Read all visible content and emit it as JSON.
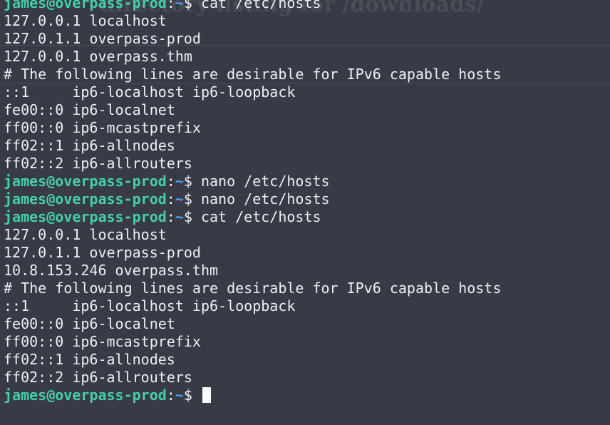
{
  "background_text": "directory listing for /downloads/",
  "colors": {
    "background": "#383a45",
    "user_host": "#45cfa6",
    "path": "#4ea0ff",
    "text": "#eceff4"
  },
  "prompt": {
    "user_host": "james@overpass-prod",
    "colon": ":",
    "path": "~",
    "dollar": "$ "
  },
  "lines": [
    {
      "type": "prompt",
      "command": "cat /etc/hosts"
    },
    {
      "type": "output",
      "text": "127.0.0.1 localhost"
    },
    {
      "type": "output",
      "text": "127.0.1.1 overpass-prod"
    },
    {
      "type": "output",
      "text": "127.0.0.1 overpass.thm"
    },
    {
      "type": "output",
      "text": "# The following lines are desirable for IPv6 capable hosts"
    },
    {
      "type": "output",
      "text": "::1     ip6-localhost ip6-loopback"
    },
    {
      "type": "output",
      "text": "fe00::0 ip6-localnet"
    },
    {
      "type": "output",
      "text": "ff00::0 ip6-mcastprefix"
    },
    {
      "type": "output",
      "text": "ff02::1 ip6-allnodes"
    },
    {
      "type": "output",
      "text": "ff02::2 ip6-allrouters"
    },
    {
      "type": "prompt",
      "command": "nano /etc/hosts"
    },
    {
      "type": "prompt",
      "command": "nano /etc/hosts"
    },
    {
      "type": "prompt",
      "command": "cat /etc/hosts"
    },
    {
      "type": "output",
      "text": "127.0.0.1 localhost"
    },
    {
      "type": "output",
      "text": "127.0.1.1 overpass-prod"
    },
    {
      "type": "output",
      "text": "10.8.153.246 overpass.thm"
    },
    {
      "type": "output",
      "text": "# The following lines are desirable for IPv6 capable hosts"
    },
    {
      "type": "output",
      "text": "::1     ip6-localhost ip6-loopback"
    },
    {
      "type": "output",
      "text": "fe00::0 ip6-localnet"
    },
    {
      "type": "output",
      "text": "ff00::0 ip6-mcastprefix"
    },
    {
      "type": "output",
      "text": "ff02::1 ip6-allnodes"
    },
    {
      "type": "output",
      "text": "ff02::2 ip6-allrouters"
    },
    {
      "type": "prompt",
      "command": "",
      "cursor": true
    }
  ]
}
